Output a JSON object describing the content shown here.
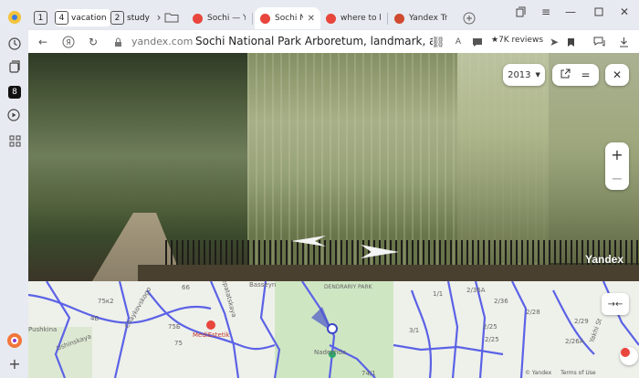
{
  "tab_groups": [
    {
      "number": "1",
      "name": ""
    },
    {
      "number": "4",
      "name": "vacation"
    },
    {
      "number": "2",
      "name": "study"
    }
  ],
  "tabs": [
    {
      "title": "Sochi — Ya",
      "active": false,
      "favicon_color": "#e8453c"
    },
    {
      "title": "Sochi Na",
      "active": true,
      "favicon_color": "#e8453c"
    },
    {
      "title": "where to bu",
      "active": false,
      "favicon_color": "#e8453c"
    },
    {
      "title": "Yandex Tran",
      "active": false,
      "favicon_color": "#d04a2f"
    }
  ],
  "address_bar": {
    "domain": "yandex.com",
    "page_title": "Sochi National Park Arboretum, landmark, attract...",
    "reviews": "★7K reviews"
  },
  "sidebar": {
    "badge": "8"
  },
  "panorama": {
    "year": "2013",
    "watermark": "Yandex"
  },
  "map": {
    "labels": [
      {
        "text": "Basseyn"
      },
      {
        "text": "DENDRARIY PARK"
      },
      {
        "text": "Nadezhda"
      },
      {
        "text": "MediEstetik"
      },
      {
        "text": "Pushkina"
      },
      {
        "text": "Ushinskaya"
      },
      {
        "text": "Chaykovskogo"
      },
      {
        "text": "Depatatskaya"
      },
      {
        "text": "75к2"
      },
      {
        "text": "4Б"
      },
      {
        "text": "75Б"
      },
      {
        "text": "75"
      },
      {
        "text": "66"
      },
      {
        "text": "1/1"
      },
      {
        "text": "3/1"
      },
      {
        "text": "2/36A"
      },
      {
        "text": "2/36"
      },
      {
        "text": "2/25"
      },
      {
        "text": "2/28"
      },
      {
        "text": "2/29"
      },
      {
        "text": "2/26A"
      },
      {
        "text": "2/25"
      },
      {
        "text": "74/1"
      },
      {
        "text": "Yakhi St"
      }
    ],
    "attribution": {
      "provider": "© Yandex",
      "terms": "Terms of Use"
    }
  },
  "colors": {
    "accent": "#e8453c",
    "map_route": "#5b62e6"
  }
}
